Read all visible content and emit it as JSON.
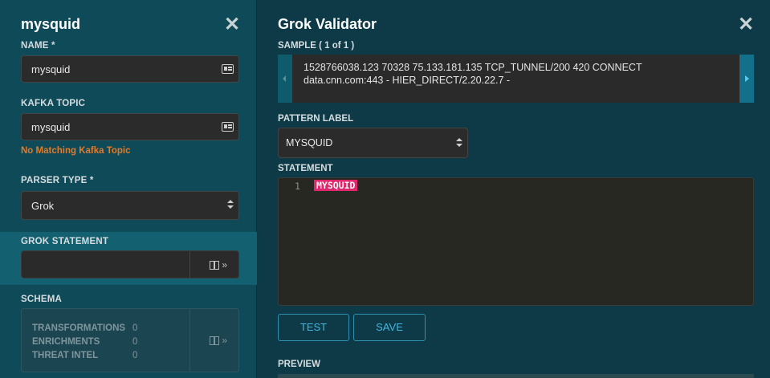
{
  "left_panel": {
    "title": "mysquid",
    "name_label": "NAME *",
    "name_value": "mysquid",
    "kafka_label": "KAFKA TOPIC",
    "kafka_value": "mysquid",
    "kafka_warning": "No Matching Kafka Topic",
    "parser_label": "PARSER TYPE *",
    "parser_value": "Grok",
    "grok_label": "GROK STATEMENT",
    "grok_expand": "»",
    "schema_label": "SCHEMA",
    "schema_expand": "»",
    "schema_rows": [
      {
        "label": "TRANSFORMATIONS",
        "count": "0"
      },
      {
        "label": "ENRICHMENTS",
        "count": "0"
      },
      {
        "label": "THREAT INTEL",
        "count": "0"
      }
    ],
    "close_icon": "close-x-icon"
  },
  "validator": {
    "title": "Grok Validator",
    "sample_label": "SAMPLE ( 1 of 1 )",
    "sample_line1": "1528766038.123  70328 75.133.181.135 TCP_TUNNEL/200 420 CONNECT",
    "sample_line2": "data.cnn.com:443 - HIER_DIRECT/2.20.22.7 -",
    "pattern_label": "PATTERN LABEL",
    "pattern_value": "MYSQUID",
    "statement_label": "STATEMENT",
    "editor_line_number": "1",
    "editor_token": "MYSQUID",
    "test_button": "TEST",
    "save_button": "SAVE",
    "preview_label": "PREVIEW"
  },
  "colors": {
    "left_bg": "#0f4a58",
    "right_bg": "#0d3a46",
    "highlight_band": "#136071",
    "warning": "#e07b2c",
    "token_bg": "#e0266f",
    "button_text": "#43b7e0"
  }
}
